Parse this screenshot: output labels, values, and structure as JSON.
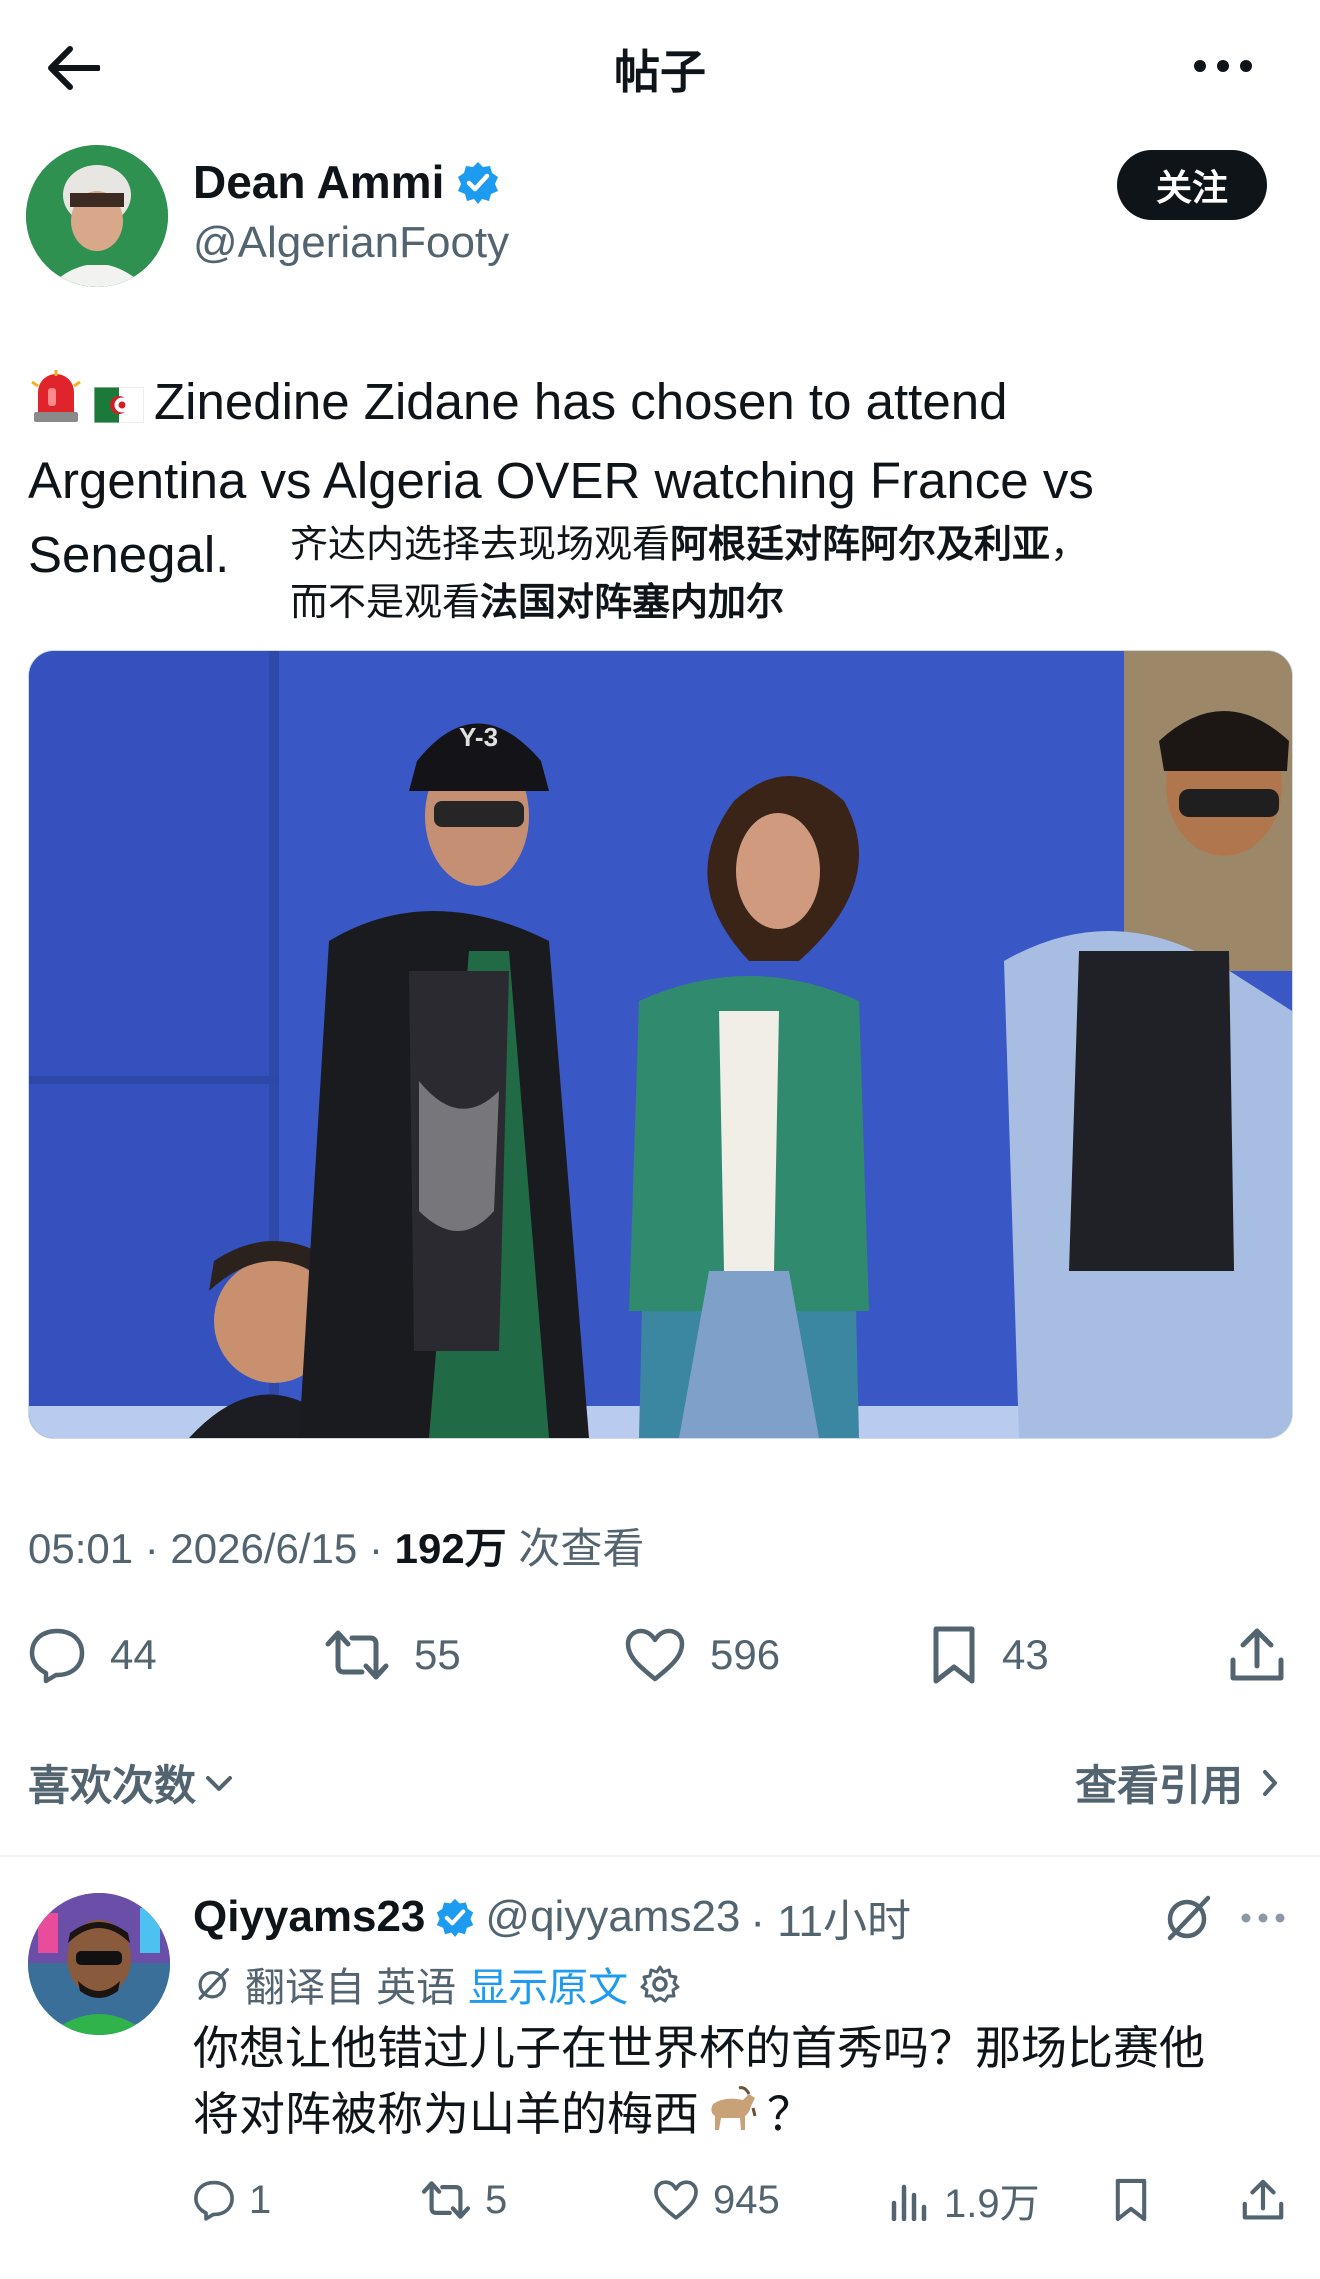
{
  "header": {
    "title": "帖子",
    "back_icon": "arrow-left-icon",
    "more_icon": "more-horizontal-icon"
  },
  "author": {
    "name": "Dean Ammi",
    "handle": "@AlgerianFooty",
    "verified": true,
    "follow_label": "关注"
  },
  "tweet": {
    "emojis": [
      "🚨",
      "🇩🇿"
    ],
    "text_line1": "Zinedine Zidane has chosen to attend",
    "text_line2": "Argentina vs Algeria OVER watching France vs",
    "text_line3": "Senegal.",
    "translation_part1": "齐达内选择去现场观看",
    "translation_bold1": "阿根廷对阵阿尔及利亚",
    "translation_part2": "，",
    "translation_part3": "而不是观看",
    "translation_bold2": "法国对阵塞内加尔"
  },
  "meta": {
    "time": "05:01 · 2026/6/15 · ",
    "views_count": "192万",
    "views_label": " 次查看"
  },
  "actions": {
    "replies": "44",
    "retweets": "55",
    "likes": "596",
    "bookmarks": "43"
  },
  "likes_label": "喜欢次数",
  "quotes_label": "查看引用",
  "reply": {
    "name": "Qiyyams23",
    "handle": "@qiyyams23",
    "time": "· 11小时",
    "verified": true,
    "translated_from": "翻译自 英语",
    "show_original": "显示原文",
    "text_line1": "你想让他错过儿子在世界杯的首秀吗？那场比赛他",
    "text_line2": "将对阵被称为山羊的梅西",
    "text_emoji": "🐐",
    "text_end": "？",
    "replies": "1",
    "retweets": "5",
    "likes": "945",
    "views": "1.9万"
  },
  "colors": {
    "text": "#0f1419",
    "secondary": "#536471",
    "link": "#1d9bf0",
    "verified": "#1d9bf0"
  }
}
